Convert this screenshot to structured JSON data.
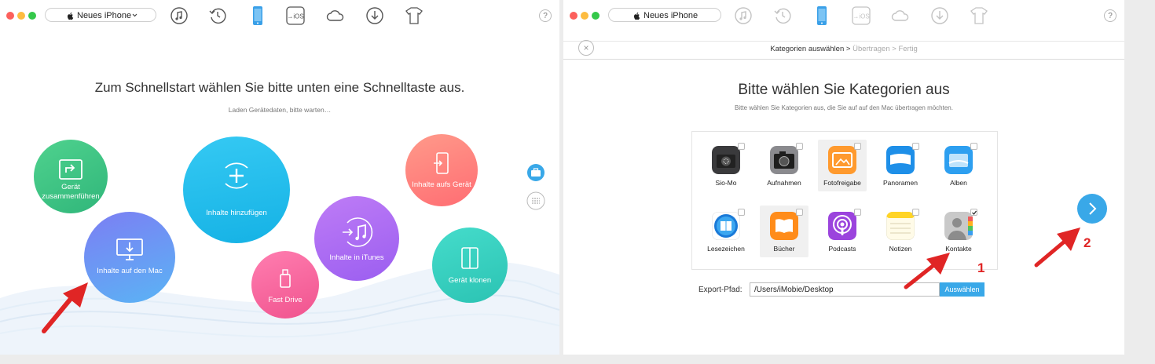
{
  "left_window": {
    "device_selector": "Neues iPhone",
    "toolbar_icons": [
      "music-library-icon",
      "time-machine-icon",
      "iphone-icon",
      "ios-update-icon",
      "icloud-icon",
      "download-icon",
      "ringtone-icon"
    ],
    "help": "?",
    "headline": "Zum Schnellstart wählen Sie bitte unten eine Schnelltaste aus.",
    "subline": "Laden Gerätedaten, bitte warten…",
    "bubbles": {
      "merge": "Gerät zusammenführen",
      "add": "Inhalte hinzufügen",
      "to_mac": "Inhalte auf den Mac",
      "fast_drive": "Fast Drive",
      "itunes": "Inhalte in iTunes",
      "to_device": "Inhalte aufs Gerät",
      "clone": "Gerät klonen"
    }
  },
  "right_window": {
    "device_selector": "Neues iPhone",
    "help": "?",
    "close": "×",
    "steps": {
      "current": "Kategorien auswählen",
      "sep": ">",
      "next": "Übertragen",
      "last": "Fertig"
    },
    "title": "Bitte wählen Sie Kategorien aus",
    "subtitle": "Bitte wählen Sie Kategorien aus, die Sie auf auf den Mac übertragen möchten.",
    "categories": [
      {
        "label": "Sio-Mo",
        "checked": false
      },
      {
        "label": "Aufnahmen",
        "checked": false
      },
      {
        "label": "Fotofreigabe",
        "checked": false
      },
      {
        "label": "Panoramen",
        "checked": false
      },
      {
        "label": "Alben",
        "checked": false
      },
      {
        "label": "Lesezeichen",
        "checked": false
      },
      {
        "label": "Bücher",
        "checked": false
      },
      {
        "label": "Podcasts",
        "checked": false
      },
      {
        "label": "Notizen",
        "checked": false
      },
      {
        "label": "Kontakte",
        "checked": true
      }
    ],
    "export_label": "Export-Pfad:",
    "export_path": "/Users/iMobie/Desktop",
    "export_button": "Auswählen",
    "step_marker_1": "1",
    "step_marker_2": "2"
  },
  "colors": {
    "accent_blue": "#39a8e8",
    "arrow_red": "#e02525",
    "traffic_red": "#fc605c",
    "traffic_yellow": "#fdbc40",
    "traffic_green": "#34c84a"
  }
}
